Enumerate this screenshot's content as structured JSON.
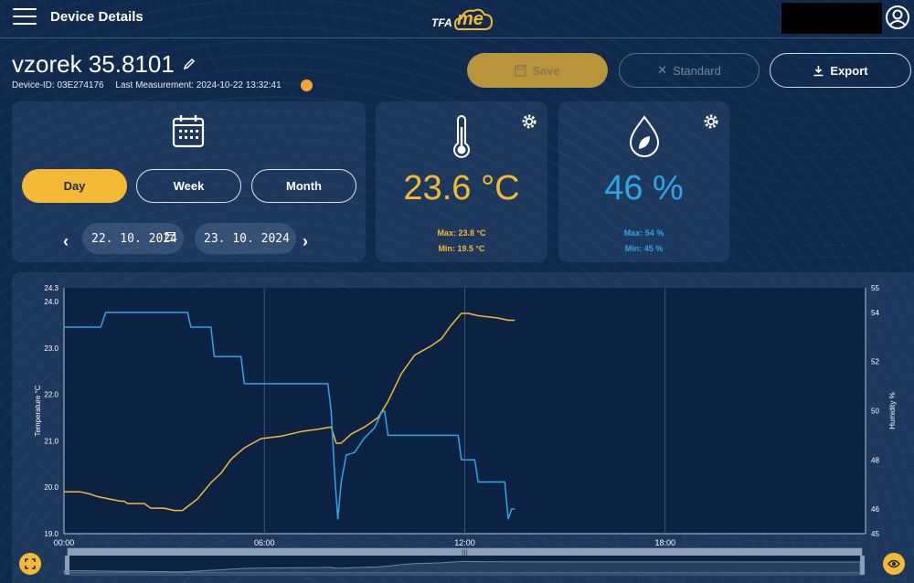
{
  "topbar": {
    "title": "Device Details",
    "logo_tfa": "TFA",
    "logo_me": "me"
  },
  "device": {
    "name": "vzorek 35.8101",
    "id_text": "Device-ID: 03E274176",
    "last_measurement": "Last Measurement: 2024-10-22 13:32:41"
  },
  "actions": {
    "save": "Save",
    "standard": "Standard",
    "export": "Export"
  },
  "range": {
    "day": "Day",
    "week": "Week",
    "month": "Month",
    "selected": "Day"
  },
  "dates": {
    "from": "22. 10. 2024",
    "to": "23. 10. 2024"
  },
  "temperature": {
    "value": "23.6 °C",
    "max": "Max: 23.8 °C",
    "min": "Min: 19.5 °C"
  },
  "humidity": {
    "value": "46 %",
    "max": "Max: 54 %",
    "min": "Min: 45 %"
  },
  "colors": {
    "accent": "#f6b935",
    "humidity": "#2ea5e6",
    "background": "#0f2a4d"
  },
  "icons": {
    "menu": "hamburger-icon",
    "user": "user-icon",
    "edit": "pencil-icon",
    "alert": "alert-icon",
    "save": "save-icon",
    "close": "close-icon",
    "export": "download-icon",
    "calendar": "calendar-icon",
    "thermometer": "thermometer-icon",
    "drop": "drop-icon",
    "settings": "gear-icon",
    "expand": "expand-icon",
    "eye": "eye-icon"
  },
  "chart_data": {
    "type": "line",
    "x_ticks": [
      "00:00",
      "06:00",
      "12:00",
      "18:00"
    ],
    "x_range_hours": [
      0,
      24
    ],
    "y_left": {
      "label": "Temperature °C",
      "ticks": [
        "19.0",
        "20.0",
        "21.0",
        "22.0",
        "23.0",
        "24.0",
        "24.3"
      ],
      "range": [
        19.0,
        24.3
      ]
    },
    "y_right": {
      "label": "Humidity %",
      "ticks": [
        "45",
        "46",
        "48",
        "50",
        "52",
        "54",
        "55"
      ],
      "range": [
        45,
        55
      ]
    },
    "series": [
      {
        "axis": "left",
        "color": "#f6b935",
        "points": [
          [
            0,
            19.9
          ],
          [
            0.5,
            19.9
          ],
          [
            0.8,
            19.85
          ],
          [
            1.0,
            19.8
          ],
          [
            1.7,
            19.7
          ],
          [
            1.8,
            19.7
          ],
          [
            1.9,
            19.65
          ],
          [
            2.4,
            19.65
          ],
          [
            2.6,
            19.55
          ],
          [
            3.0,
            19.55
          ],
          [
            3.3,
            19.5
          ],
          [
            3.55,
            19.5
          ],
          [
            4.0,
            19.75
          ],
          [
            4.4,
            20.1
          ],
          [
            4.7,
            20.3
          ],
          [
            5.0,
            20.6
          ],
          [
            5.4,
            20.85
          ],
          [
            5.9,
            21.05
          ],
          [
            6.5,
            21.1
          ],
          [
            7.1,
            21.2
          ],
          [
            7.6,
            21.25
          ],
          [
            8.0,
            21.3
          ],
          [
            8.15,
            20.95
          ],
          [
            8.3,
            20.95
          ],
          [
            8.6,
            21.15
          ],
          [
            9.0,
            21.3
          ],
          [
            9.4,
            21.5
          ],
          [
            9.7,
            21.85
          ],
          [
            10.1,
            22.45
          ],
          [
            10.5,
            22.85
          ],
          [
            11.0,
            23.05
          ],
          [
            11.3,
            23.2
          ],
          [
            11.6,
            23.5
          ],
          [
            11.9,
            23.75
          ],
          [
            12.1,
            23.75
          ],
          [
            12.4,
            23.7
          ],
          [
            13.0,
            23.65
          ],
          [
            13.3,
            23.6
          ],
          [
            13.5,
            23.6
          ]
        ]
      },
      {
        "axis": "right",
        "color": "#2ea5e6",
        "points": [
          [
            0,
            53.4
          ],
          [
            1.1,
            53.4
          ],
          [
            1.25,
            54
          ],
          [
            3.7,
            54
          ],
          [
            3.8,
            53.4
          ],
          [
            4.4,
            53.4
          ],
          [
            4.5,
            52.2
          ],
          [
            5.3,
            52.2
          ],
          [
            5.4,
            51.1
          ],
          [
            7.9,
            51.1
          ],
          [
            8.0,
            50
          ],
          [
            8.1,
            47.5
          ],
          [
            8.2,
            45.6
          ],
          [
            8.3,
            47.1
          ],
          [
            8.45,
            48.2
          ],
          [
            8.7,
            48.3
          ],
          [
            9.0,
            48.9
          ],
          [
            9.3,
            49.3
          ],
          [
            9.5,
            49.9
          ],
          [
            9.6,
            50.0
          ],
          [
            9.7,
            49.0
          ],
          [
            11.8,
            49.0
          ],
          [
            11.9,
            48
          ],
          [
            12.3,
            48
          ],
          [
            12.4,
            47.1
          ],
          [
            13.2,
            47.1
          ],
          [
            13.3,
            45.6
          ],
          [
            13.4,
            46
          ],
          [
            13.5,
            46
          ]
        ]
      }
    ]
  }
}
